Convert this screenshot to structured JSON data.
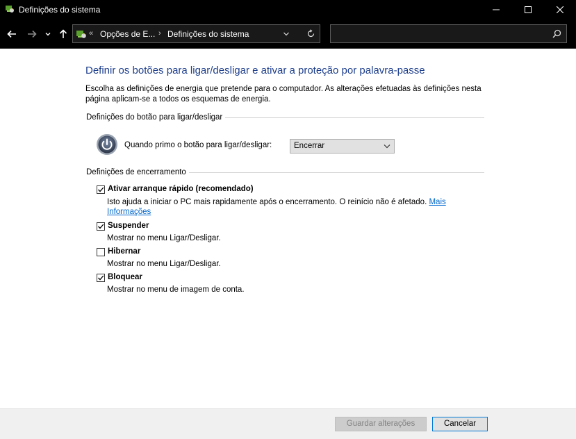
{
  "window": {
    "title": "Definições do sistema"
  },
  "address_bar": {
    "overflow": "«",
    "crumb_1": "Opções de E...",
    "crumb_2": "Definições do sistema"
  },
  "search": {
    "placeholder": ""
  },
  "page": {
    "heading": "Definir os botões para ligar/desligar e ativar a proteção por palavra-passe",
    "intro": "Escolha as definições de energia que pretende para o computador. As alterações efetuadas às definições nesta página aplicam-se a todos os esquemas de energia."
  },
  "power_button_section": {
    "label": "Definições do botão para ligar/desligar",
    "prompt": "Quando primo o botão para ligar/desligar:",
    "selected": "Encerrar"
  },
  "shutdown_section": {
    "label": "Definições de encerramento",
    "items": [
      {
        "label": "Ativar arranque rápido (recomendado)",
        "checked": true,
        "description": "Isto ajuda a iniciar o PC mais rapidamente após o encerramento. O reinício não é afetado. ",
        "link": "Mais Informações"
      },
      {
        "label": "Suspender",
        "checked": true,
        "description": "Mostrar no menu Ligar/Desligar."
      },
      {
        "label": "Hibernar",
        "checked": false,
        "description": "Mostrar no menu Ligar/Desligar."
      },
      {
        "label": "Bloquear",
        "checked": true,
        "description": "Mostrar no menu de imagem de conta."
      }
    ]
  },
  "footer": {
    "save_label": "Guardar alterações",
    "cancel_label": "Cancelar"
  },
  "icons": {
    "app": "power-options-icon",
    "back": "arrow-left-icon",
    "forward": "arrow-right-icon",
    "recent": "chevron-down-icon",
    "up": "arrow-up-icon",
    "refresh": "refresh-icon",
    "search": "search-icon",
    "power": "power-button-icon"
  },
  "colors": {
    "title_bar": "#000000",
    "heading": "#1e3f8c",
    "link": "#0066cc",
    "footer": "#f0f0f0"
  }
}
